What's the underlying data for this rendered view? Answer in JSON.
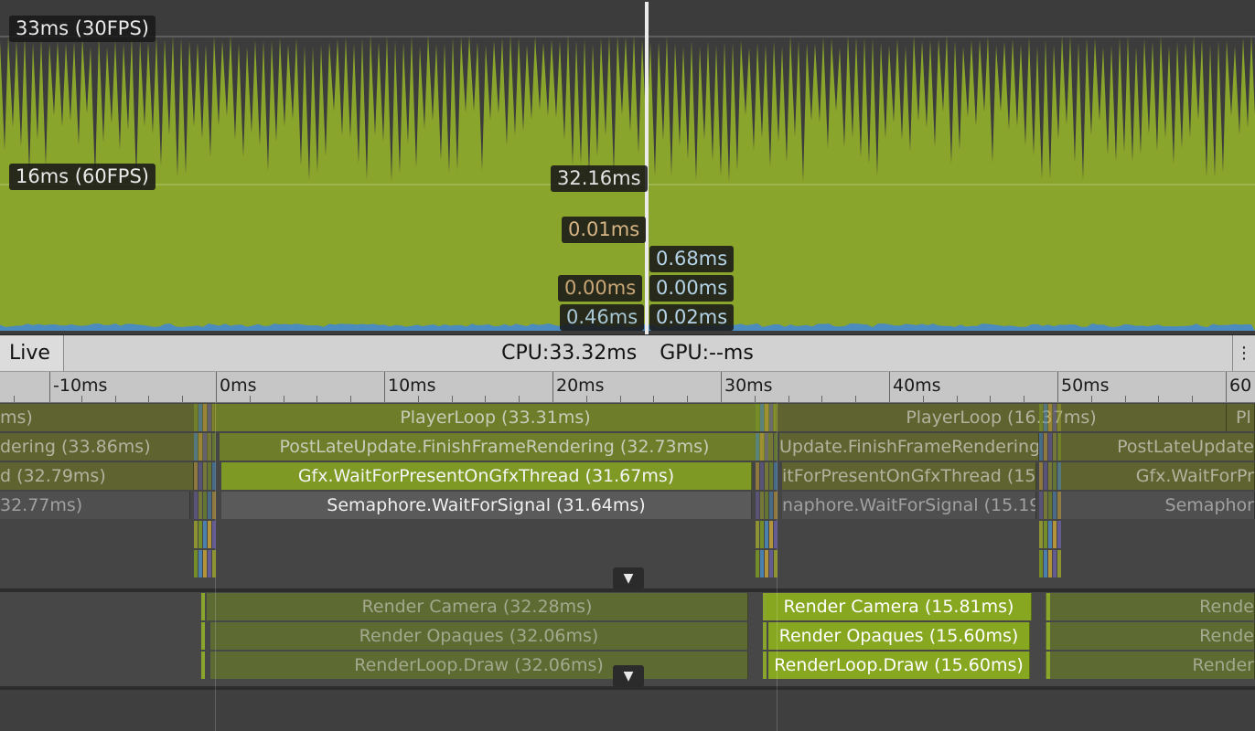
{
  "chart": {
    "ref_30fps": "33ms (30FPS)",
    "ref_60fps": "16ms (60FPS)",
    "selected_values": {
      "total": "32.16ms",
      "rendering": "0.01ms",
      "scripts_a": "0.00ms",
      "scripts_b": "0.46ms",
      "gpu_a": "0.68ms",
      "gpu_b": "0.00ms",
      "gpu_c": "0.02ms"
    },
    "colors": {
      "main": "#8aa52b",
      "bg": "#3c3c3c",
      "scripts": "#4b8bbd",
      "cursor": "#eaeaea"
    }
  },
  "statusbar": {
    "live": "Live",
    "cpu": "CPU:33.32ms",
    "gpu": "GPU:--ms"
  },
  "ruler": {
    "labels": [
      "-10ms",
      "0ms",
      "10ms",
      "20ms",
      "30ms",
      "40ms",
      "50ms",
      "60"
    ]
  },
  "main_thread": {
    "row1": {
      "left": "ms)",
      "center": "PlayerLoop (33.31ms)",
      "right": "PlayerLoop (16.37ms)",
      "far": "Pl"
    },
    "row2": {
      "left": "dering (33.86ms)",
      "center": "PostLateUpdate.FinishFrameRendering (32.73ms)",
      "right": "Update.FinishFrameRendering (",
      "far": "PostLateUpdate"
    },
    "row3": {
      "left": "d (32.79ms)",
      "center": "Gfx.WaitForPresentOnGfxThread (31.67ms)",
      "right": "itForPresentOnGfxThread (15",
      "far": "Gfx.WaitForPr"
    },
    "row4": {
      "left": "32.77ms)",
      "center": "Semaphore.WaitForSignal (31.64ms)",
      "right": "naphore.WaitForSignal (15.19",
      "far": "Semaphor"
    }
  },
  "render_thread": {
    "row1": {
      "center": "Render Camera (32.28ms)",
      "right": "Render Camera (15.81ms)",
      "far": "Rende"
    },
    "row2": {
      "center": "Render Opaques (32.06ms)",
      "right": "Render Opaques (15.60ms)",
      "far": "Rende"
    },
    "row3": {
      "center": "RenderLoop.Draw (32.06ms)",
      "right": "RenderLoop.Draw (15.60ms)",
      "far": "Render"
    }
  },
  "icons": {
    "collapse": "triangle-down-icon",
    "menu": "kebab-menu-icon"
  }
}
